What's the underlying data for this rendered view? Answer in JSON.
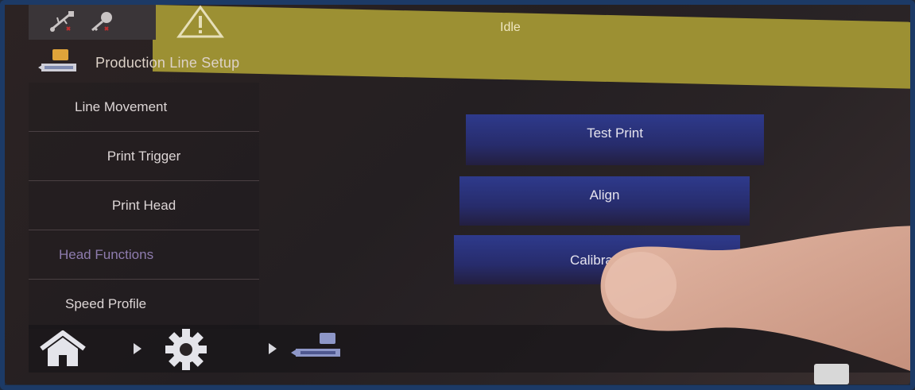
{
  "status": {
    "text": "Idle",
    "usb_icon": "usb-icon",
    "key_icon": "key-icon",
    "warning_icon": "warning-icon"
  },
  "header": {
    "title": "Production Line Setup",
    "icon": "production-line-icon"
  },
  "side_menu": {
    "items": [
      {
        "label": "Line Movement"
      },
      {
        "label": "Print Trigger"
      },
      {
        "label": "Print Head"
      },
      {
        "label": "Head Functions"
      },
      {
        "label": "Speed Profile"
      }
    ]
  },
  "actions": {
    "test_print": "Test Print",
    "align": "Align",
    "calibrate": "Calibrate"
  },
  "bottom_nav": {
    "home_icon": "home-icon",
    "settings_icon": "gear-icon",
    "production_icon": "production-line-icon"
  },
  "colors": {
    "status_banner": "#9c9033",
    "button": "#2e3a8c",
    "menu_selected_text": "#8e7cae",
    "bezel": "#1c3a66"
  }
}
